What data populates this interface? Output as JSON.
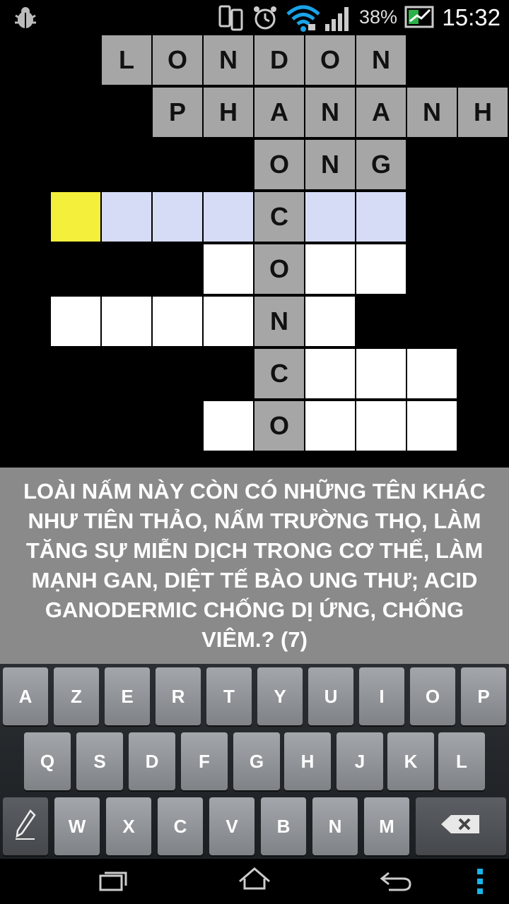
{
  "status_bar": {
    "battery_percent": "38%",
    "time": "15:32",
    "icons": [
      "debug-bug-icon",
      "phone-sync-icon",
      "alarm-clock-icon",
      "wifi-icon",
      "signal-icon",
      "battery-icon"
    ]
  },
  "grid": {
    "rows": [
      [
        "",
        "L",
        "O",
        "N",
        "D",
        "O",
        "N",
        "",
        "",
        ""
      ],
      [
        "",
        "",
        "P",
        "H",
        "A",
        "N",
        "A",
        "N",
        "H",
        ""
      ],
      [
        "",
        "",
        "",
        "",
        "O",
        "N",
        "G",
        "",
        "",
        ""
      ],
      [
        "",
        "",
        "",
        "",
        "C",
        "",
        "",
        "",
        "",
        ""
      ],
      [
        "",
        "",
        "",
        "",
        "O",
        "",
        "",
        "",
        "",
        ""
      ],
      [
        "",
        "",
        "",
        "",
        "N",
        "",
        "",
        "",
        "",
        ""
      ],
      [
        "",
        "",
        "",
        "",
        "C",
        "",
        "",
        "",
        "",
        ""
      ],
      [
        "",
        "",
        "",
        "",
        "O",
        "",
        "",
        "",
        "",
        ""
      ]
    ]
  },
  "clue": {
    "text": "LOÀI NẤM NÀY CÒN CÓ NHỮNG TÊN KHÁC NHƯ TIÊN THẢO, NẤM TRƯỜNG THỌ, LÀM TĂNG SỰ MIỄN DỊCH TRONG CƠ THỂ, LÀM MẠNH GAN, DIỆT TẾ BÀO UNG THƯ; ACID GANODERMIC CHỐNG DỊ ỨNG, CHỐNG VIÊM.? (7)"
  },
  "keyboard": {
    "row1": [
      "A",
      "Z",
      "E",
      "R",
      "T",
      "Y",
      "U",
      "I",
      "O",
      "P"
    ],
    "row2": [
      "Q",
      "S",
      "D",
      "F",
      "G",
      "H",
      "J",
      "K",
      "L"
    ],
    "row3": [
      "W",
      "X",
      "C",
      "V",
      "B",
      "N",
      "M"
    ],
    "pencil_icon": "pencil-icon",
    "backspace_icon": "backspace-icon"
  },
  "nav_bar": {
    "icons": [
      "recent-apps-icon",
      "home-icon",
      "back-icon",
      "menu-icon"
    ]
  }
}
